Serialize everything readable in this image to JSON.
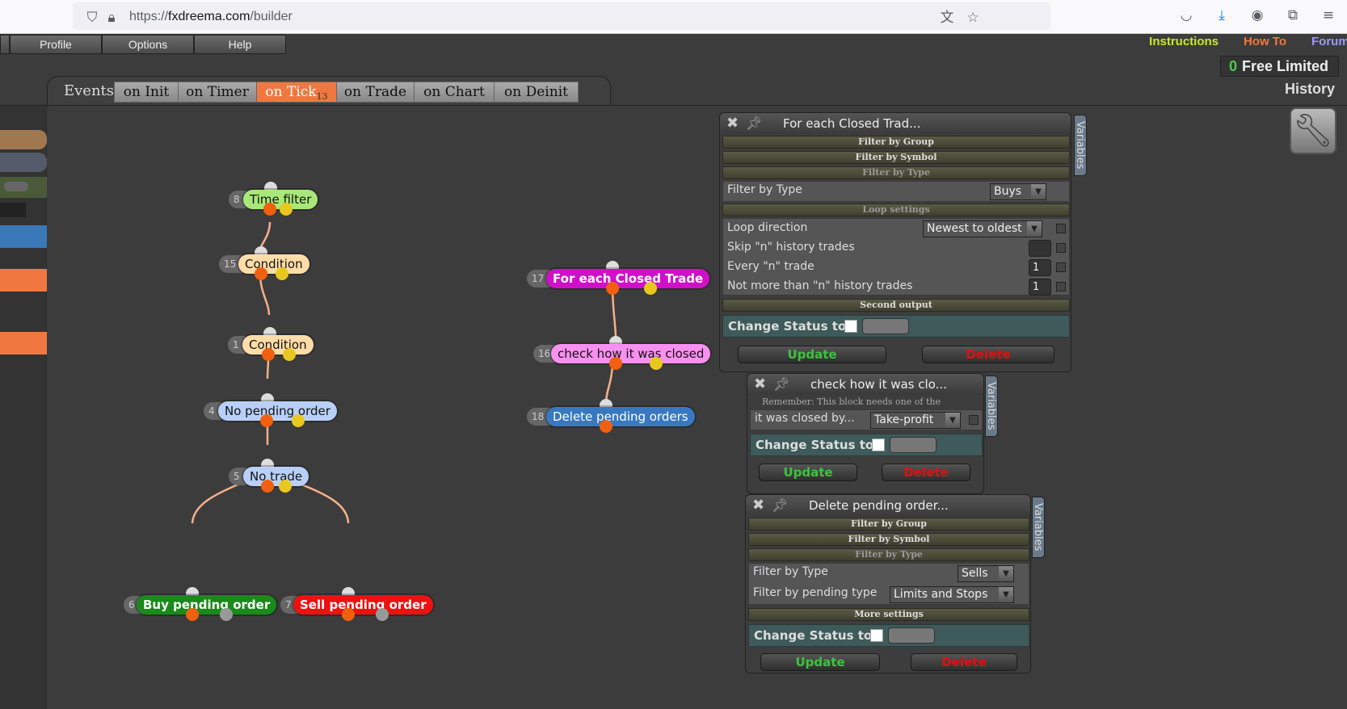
{
  "browser": {
    "url_host_prefix": "https://",
    "url_host": "fxdreema.com",
    "url_path": "/builder"
  },
  "menu": {
    "profile": "Profile",
    "options": "Options",
    "help": "Help"
  },
  "links": {
    "instructions": "Instructions",
    "howto": "How To",
    "forum": "Forum"
  },
  "plan": {
    "count": "0",
    "label": "Free Limited"
  },
  "history": "History",
  "events": {
    "label": "Events",
    "tabs": [
      {
        "label": "on Init"
      },
      {
        "label": "on Timer"
      },
      {
        "label": "on Tick",
        "badge": "13"
      },
      {
        "label": "on Trade"
      },
      {
        "label": "on Chart"
      },
      {
        "label": "on Deinit"
      }
    ]
  },
  "nodes": {
    "time_filter": {
      "num": "8",
      "label": "Time filter"
    },
    "condition15": {
      "num": "15",
      "label": "Condition"
    },
    "condition1": {
      "num": "1",
      "label": "Condition"
    },
    "no_pending": {
      "num": "4",
      "label": "No pending order"
    },
    "no_trade": {
      "num": "5",
      "label": "No trade"
    },
    "buy_pending": {
      "num": "6",
      "label": "Buy pending order"
    },
    "sell_pending": {
      "num": "7",
      "label": "Sell pending order"
    },
    "for_each": {
      "num": "17",
      "label": "For each Closed Trade"
    },
    "check_closed": {
      "num": "16",
      "label": "check how it was closed"
    },
    "delete_pending": {
      "num": "18",
      "label": "Delete pending orders"
    }
  },
  "panel1": {
    "title": "For each Closed Trad...",
    "variables": "Variables",
    "filter_group": "Filter by Group",
    "filter_symbol": "Filter by Symbol",
    "filter_type_section": "Filter by Type",
    "filter_type_label": "Filter by Type",
    "filter_type_value": "Buys",
    "loop_settings": "Loop settings",
    "loop_direction_label": "Loop direction",
    "loop_direction_value": "Newest to oldest",
    "skip_label": "Skip \"n\" history trades",
    "skip_value": "",
    "every_label": "Every \"n\" trade",
    "every_value": "1",
    "notmore_label": "Not more than \"n\" history trades",
    "notmore_value": "1",
    "second_output": "Second output",
    "change_status": "Change Status to",
    "update": "Update",
    "delete": "Delete"
  },
  "panel2": {
    "title": "check how it was clo...",
    "variables": "Variables",
    "note": "Remember: This block needs one of the",
    "closed_by_label": "it was closed by...",
    "closed_by_value": "Take-profit",
    "change_status": "Change Status to",
    "update": "Update",
    "delete": "Delete"
  },
  "panel3": {
    "title": "Delete pending order...",
    "variables": "Variables",
    "filter_group": "Filter by Group",
    "filter_symbol": "Filter by Symbol",
    "filter_type_section": "Filter by Type",
    "filter_type_label": "Filter by Type",
    "filter_type_value": "Sells",
    "pending_type_label": "Filter by pending type",
    "pending_type_value": "Limits and Stops",
    "more_settings": "More settings",
    "change_status": "Change Status to",
    "update": "Update",
    "delete": "Delete"
  },
  "colors": {
    "instructions": "#c8e830",
    "howto": "#f07840",
    "forum": "#9a9aff",
    "time_filter": "#a8e878",
    "condition": "#ffdca8",
    "no_pending": "#b8d0f8",
    "buy": "#1a8a1a",
    "sell": "#ee1111",
    "for_each": "#d010c8",
    "check_closed": "#f890f0",
    "delete_pending": "#3878c0"
  }
}
